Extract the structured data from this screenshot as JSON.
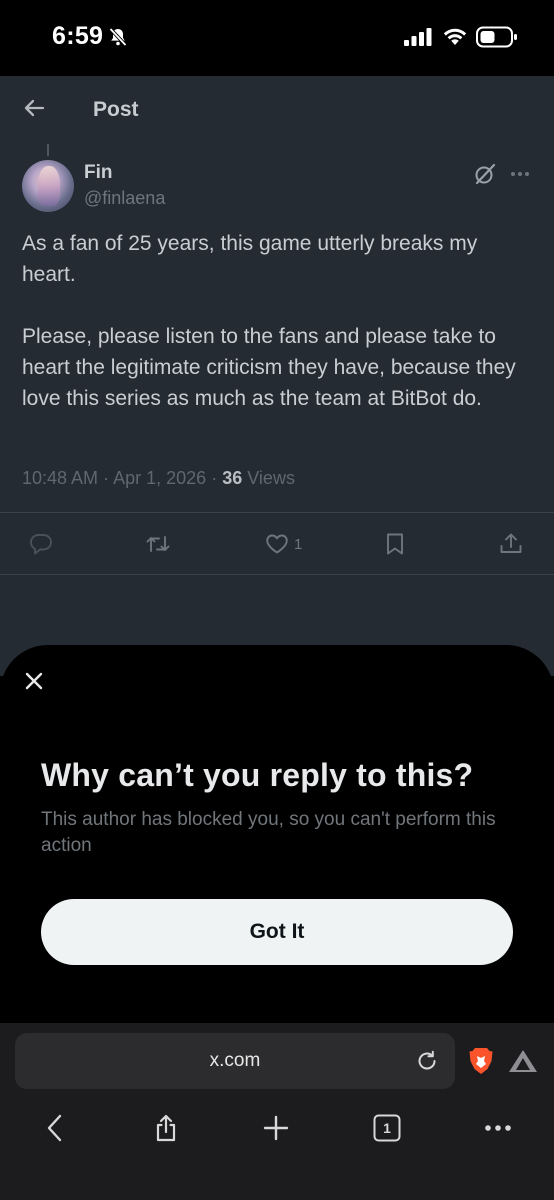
{
  "status_bar": {
    "time": "6:59",
    "icons": [
      "bell-slash-icon",
      "cellular-signal-icon",
      "wifi-icon",
      "battery-icon"
    ]
  },
  "header": {
    "title": "Post",
    "back_icon": "arrow-left-icon"
  },
  "post": {
    "author": {
      "display_name": "Fin",
      "handle": "@finlaena"
    },
    "paragraphs": [
      "As a fan of 25 years, this game utterly breaks my heart.",
      "Please, please listen to the fans and please take to heart the legitimate criticism they have, because they love this series as much as the team at BitBot do."
    ],
    "time": "10:48 AM",
    "separator": "·",
    "date": "Apr 1, 2026",
    "views_count": "36",
    "views_label": "Views",
    "actions": {
      "reply_icon": "speech-bubble-icon",
      "repost_icon": "repost-arrows-icon",
      "like_icon": "heart-icon",
      "like_count": "1",
      "bookmark_icon": "bookmark-icon",
      "share_icon": "share-upload-icon"
    }
  },
  "sheet": {
    "title": "Why can’t you reply to this?",
    "description": "This author has blocked you, so you can't perform this action",
    "button_label": "Got It",
    "close_icon": "close-icon"
  },
  "browser": {
    "url": "x.com",
    "tab_count": "1",
    "icons": [
      "reload-icon",
      "brave-lion-icon",
      "aurora-triangle-icon",
      "chevron-left-icon",
      "share-icon",
      "plus-icon",
      "tabs-icon",
      "more-dots-icon"
    ]
  },
  "colors": {
    "page_bg_dimmed": "#252b33",
    "sheet_bg": "#000000",
    "button_bg": "#eff3f4",
    "secondary_text": "#71767b",
    "brave_orange": "#fb542b"
  }
}
